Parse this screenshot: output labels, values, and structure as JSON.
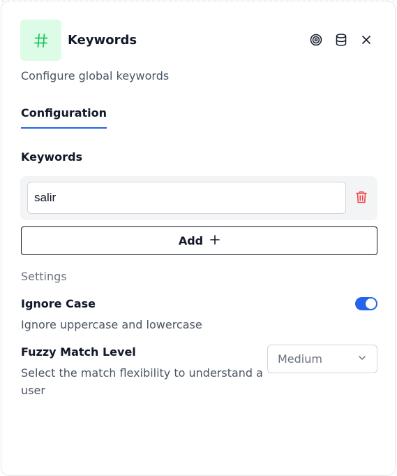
{
  "header": {
    "icon": "hash-icon",
    "title": "Keywords",
    "description": "Configure global keywords",
    "actions": [
      "target-icon",
      "database-icon",
      "close-icon"
    ]
  },
  "tabs": [
    {
      "label": "Configuration",
      "active": true
    }
  ],
  "keywords_section": {
    "label": "Keywords",
    "items": [
      {
        "value": "salir"
      }
    ],
    "add_label": "Add"
  },
  "settings": {
    "heading": "Settings",
    "ignore_case": {
      "title": "Ignore Case",
      "description": "Ignore uppercase and lowercase",
      "enabled": true
    },
    "fuzzy_match": {
      "title": "Fuzzy Match Level",
      "description": "Select the match flexibility to understand a user",
      "selected": "Medium"
    }
  },
  "colors": {
    "accent": "#2563eb",
    "icon_bg": "#dcfce7",
    "icon_fg": "#22c55e",
    "danger": "#ef4444"
  }
}
